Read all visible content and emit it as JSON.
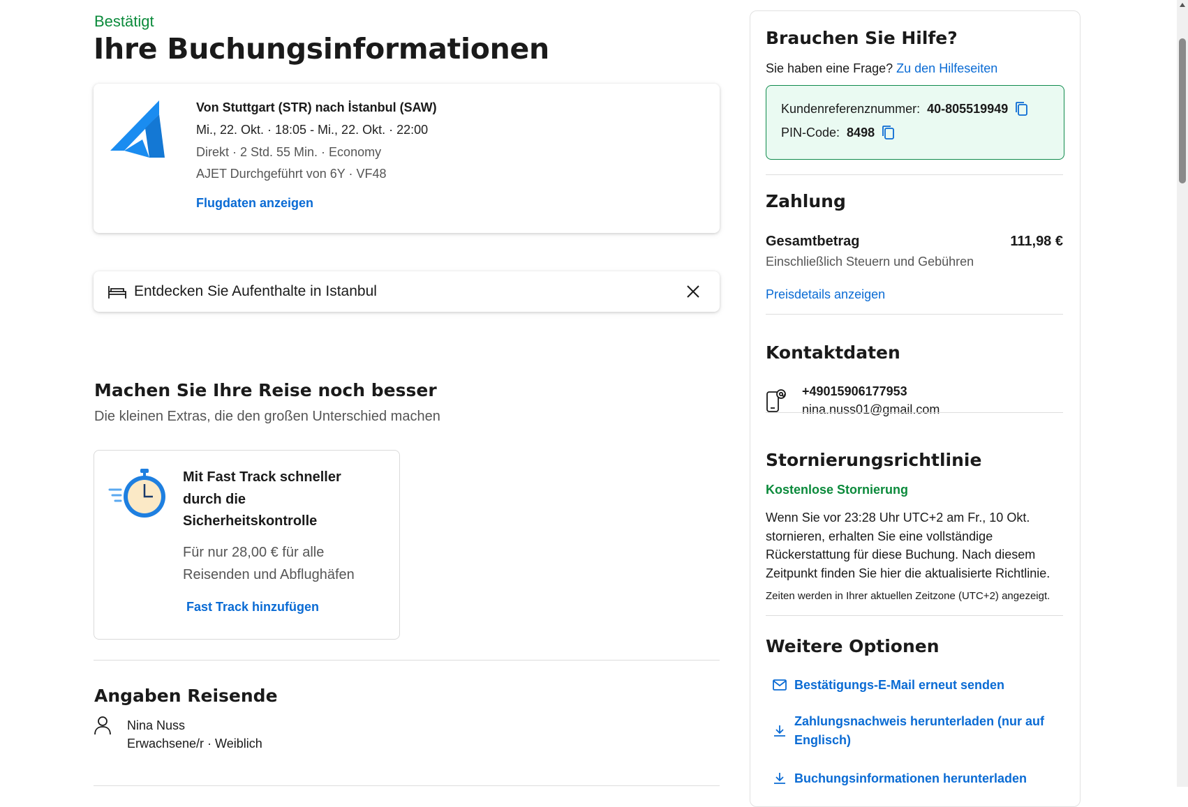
{
  "header": {
    "status": "Bestätigt",
    "title": "Ihre Buchungsinformationen"
  },
  "flight": {
    "route": "Von Stuttgart (STR) nach İstanbul (SAW)",
    "time": "Mi., 22. Okt. · 18:05 - Mi., 22. Okt. · 22:00",
    "details": "Direkt · 2 Std. 55 Min. · Economy",
    "operator": "AJET Durchgeführt von 6Y · VF48",
    "link": "Flugdaten anzeigen",
    "logo_icon": "ajet-logo-icon",
    "logo_color": "#1a8cf0"
  },
  "stay": {
    "text": "Entdecken Sie Aufenthalte in Istanbul",
    "icon": "bed-icon"
  },
  "improve": {
    "title": "Machen Sie Ihre Reise noch besser",
    "subtitle": "Die kleinen Extras, die den großen Unterschied machen"
  },
  "fasttrack": {
    "title": "Mit Fast Track schneller durch die Sicherheitskontrolle",
    "description": "Für nur 28,00 € für alle Reisenden und Abflughäfen",
    "link": "Fast Track hinzufügen",
    "icon": "stopwatch-icon"
  },
  "travellers": {
    "title": "Angaben Reisende",
    "name": "Nina Nuss",
    "info": "Erwachsene/r · Weiblich"
  },
  "help": {
    "title": "Brauchen Sie Hilfe?",
    "question": "Sie haben eine Frage?",
    "link": "Zu den Hilfeseiten",
    "ref_label": "Kundenreferenznummer:",
    "ref_value": "40-805519949",
    "pin_label": "PIN-Code:",
    "pin_value": "8498"
  },
  "payment": {
    "title": "Zahlung",
    "total_label": "Gesamtbetrag",
    "total_value": "111,98 €",
    "note": "Einschließlich Steuern und Gebühren",
    "link": "Preisdetails anzeigen"
  },
  "contact": {
    "title": "Kontaktdaten",
    "phone": "+49015906177953",
    "email": "nina.nuss01@gmail.com"
  },
  "cancellation": {
    "title": "Stornierungsrichtlinie",
    "badge": "Kostenlose Stornierung",
    "text": "Wenn Sie vor 23:28 Uhr UTC+2 am Fr., 10 Okt. stornieren, erhalten Sie eine vollständige Rückerstattung für diese Buchung. Nach diesem Zeitpunkt finden Sie hier die aktualisierte Richtlinie.",
    "note": "Zeiten werden in Ihrer aktuellen Zeitzone (UTC+2) angezeigt."
  },
  "more": {
    "title": "Weitere Optionen",
    "options": [
      "Bestätigungs-E-Mail erneut senden",
      "Zahlungsnachweis herunterladen (nur auf Englisch)",
      "Buchungsinformationen herunterladen"
    ]
  },
  "colors": {
    "confirmed_green": "#0b8a3b",
    "link_blue": "#0a6bd4",
    "ref_box_bg": "#eafaf2",
    "ref_box_border": "#0f8a4c"
  }
}
